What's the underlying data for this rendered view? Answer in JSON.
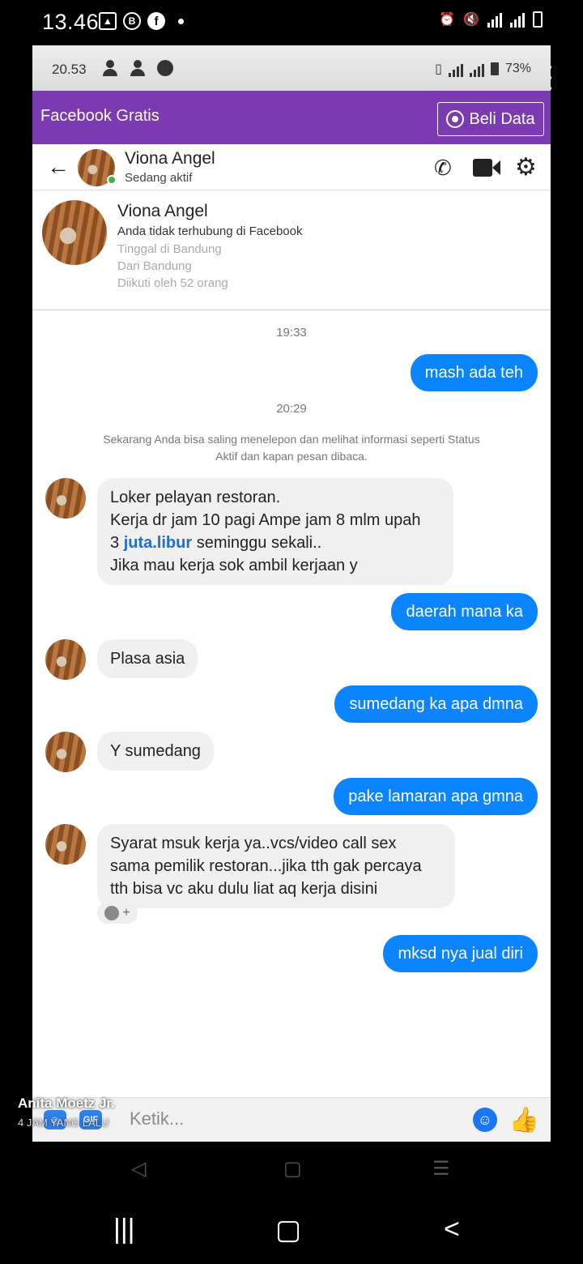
{
  "outer_status": {
    "time": "13.46",
    "icons": [
      "gallery-icon",
      "b-icon",
      "facebook-icon"
    ]
  },
  "inner_status": {
    "time": "20.53",
    "battery": "73%"
  },
  "app_bar": {
    "title": "Facebook Gratis",
    "buy_button": "Beli Data"
  },
  "chat_header": {
    "name": "Viona Angel",
    "status": "Sedang aktif"
  },
  "profile": {
    "name": "Viona Angel",
    "line1": "Anda tidak terhubung di Facebook",
    "line2": "Tinggal di Bandung",
    "line3": "Dari Bandung",
    "line4": "Diikuti oleh 52 orang"
  },
  "messages": {
    "ts1": "19:33",
    "m1": "mash ada teh",
    "ts2": "20:29",
    "system": "Sekarang Anda bisa saling menelepon dan melihat informasi seperti Status Aktif dan kapan pesan dibaca.",
    "m2_line1": "Loker pelayan restoran.",
    "m2_line2": "Kerja dr jam 10 pagi Ampe jam 8 mlm upah",
    "m2_line3_pre": "3 ",
    "m2_line3_link": "juta.libur",
    "m2_line3_post": " seminggu sekali..",
    "m2_line4": "Jika mau kerja sok ambil kerjaan y",
    "m3": "daerah mana ka",
    "m4": "Plasa asia",
    "m5": "sumedang ka apa dmna",
    "m6": "Y sumedang",
    "m7": "pake lamaran apa gmna",
    "m8_line1": "Syarat msuk kerja ya..vcs/video call sex",
    "m8_line2": "sama pemilik restoran...jika tth gak percaya",
    "m8_line3": "tth bisa vc aku dulu liat aq kerja disini",
    "m9": "mksd nya jual diri"
  },
  "composer": {
    "placeholder": "Ketik..."
  },
  "watermark": {
    "name": "Anita Moetz Jr.",
    "time": "4 JAM YANG LALU"
  }
}
